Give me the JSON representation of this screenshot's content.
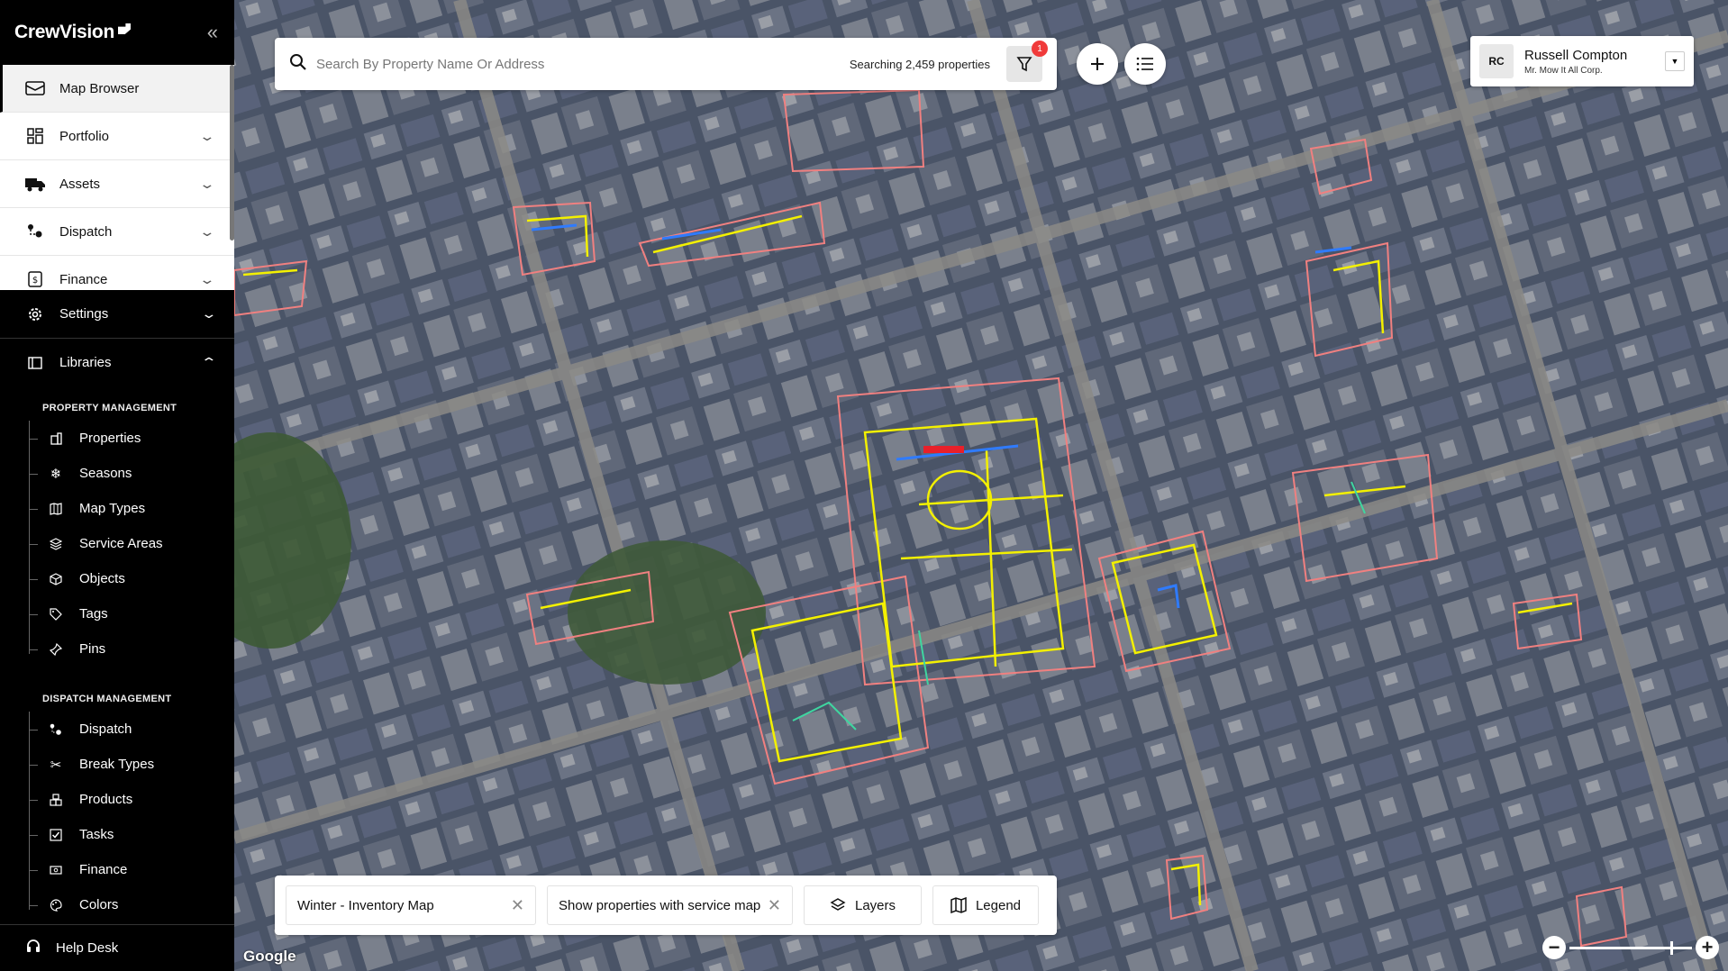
{
  "brand": {
    "name": "CrewVision"
  },
  "top_menu": [
    {
      "label": "Map Browser",
      "icon": "map-icon",
      "expandable": false,
      "active": true
    },
    {
      "label": "Portfolio",
      "icon": "grid-icon",
      "expandable": true
    },
    {
      "label": "Assets",
      "icon": "truck-icon",
      "expandable": true
    },
    {
      "label": "Dispatch",
      "icon": "dispatch-icon",
      "expandable": true
    },
    {
      "label": "Finance",
      "icon": "dollar-icon",
      "expandable": true
    }
  ],
  "settings": {
    "label": "Settings"
  },
  "libraries": {
    "label": "Libraries",
    "property_management": {
      "title": "PROPERTY MANAGEMENT",
      "items": [
        "Properties",
        "Seasons",
        "Map Types",
        "Service Areas",
        "Objects",
        "Tags",
        "Pins"
      ]
    },
    "dispatch_management": {
      "title": "DISPATCH MANAGEMENT",
      "items": [
        "Dispatch",
        "Break Types",
        "Products",
        "Tasks",
        "Finance",
        "Colors"
      ]
    }
  },
  "help": {
    "label": "Help Desk"
  },
  "search": {
    "placeholder": "Search By Property Name Or Address",
    "count_text": "Searching 2,459 properties",
    "filter_badge": "1"
  },
  "user": {
    "initials": "RC",
    "name": "Russell Compton",
    "org": "Mr. Mow It All Corp."
  },
  "bottom_bar": {
    "map_select": "Winter - Inventory Map",
    "filter_select": "Show properties with service map",
    "layers_label": "Layers",
    "legend_label": "Legend"
  },
  "map": {
    "attribution": "Google"
  },
  "colors": {
    "boundary": "#f08080",
    "service_yellow": "#f3f000",
    "service_blue": "#2f7bff",
    "service_green": "#3fd6a0"
  }
}
